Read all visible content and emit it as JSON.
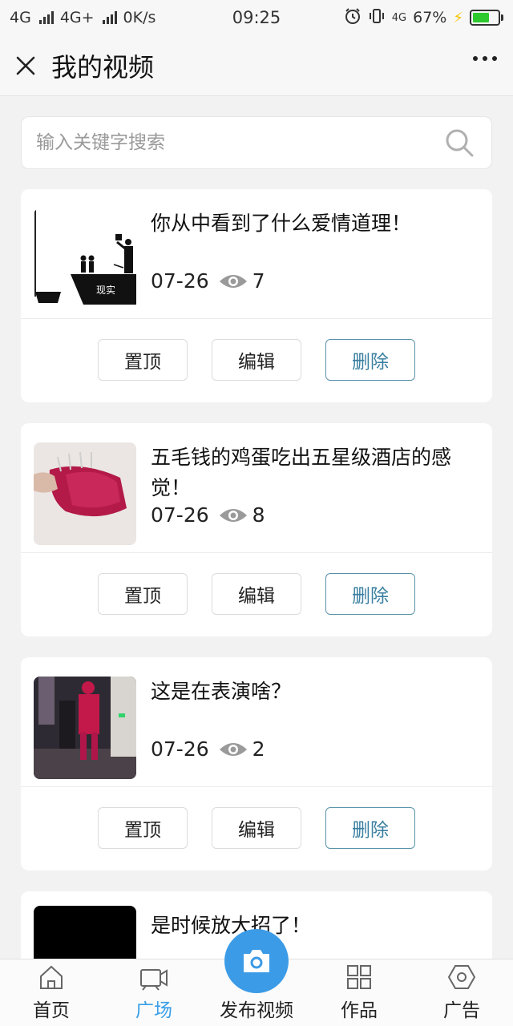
{
  "status_bar": {
    "network1": "4G",
    "network2": "4G+",
    "speed": "0K/s",
    "time": "09:25",
    "network3": "4G",
    "battery": "67%",
    "battery_level": 0.67
  },
  "header": {
    "title": "我的视频"
  },
  "search": {
    "placeholder": "输入关键字搜索"
  },
  "videos": [
    {
      "title": "你从中看到了什么爱情道理！",
      "date": "07-26",
      "views": "7",
      "thumb_caption": "现实"
    },
    {
      "title": "五毛钱的鸡蛋吃出五星级酒店的感觉！",
      "date": "07-26",
      "views": "8"
    },
    {
      "title": "这是在表演啥？",
      "date": "07-26",
      "views": "2"
    },
    {
      "title": "是时候放大招了！"
    }
  ],
  "actions": {
    "pin": "置顶",
    "edit": "编辑",
    "delete": "删除"
  },
  "tabbar": {
    "home": "首页",
    "square": "广场",
    "publish": "发布视频",
    "works": "作品",
    "ads": "广告"
  },
  "colors": {
    "accent": "#3c9be6",
    "active_tab": "#3aa0e8",
    "delete_border": "#5a93a8"
  }
}
